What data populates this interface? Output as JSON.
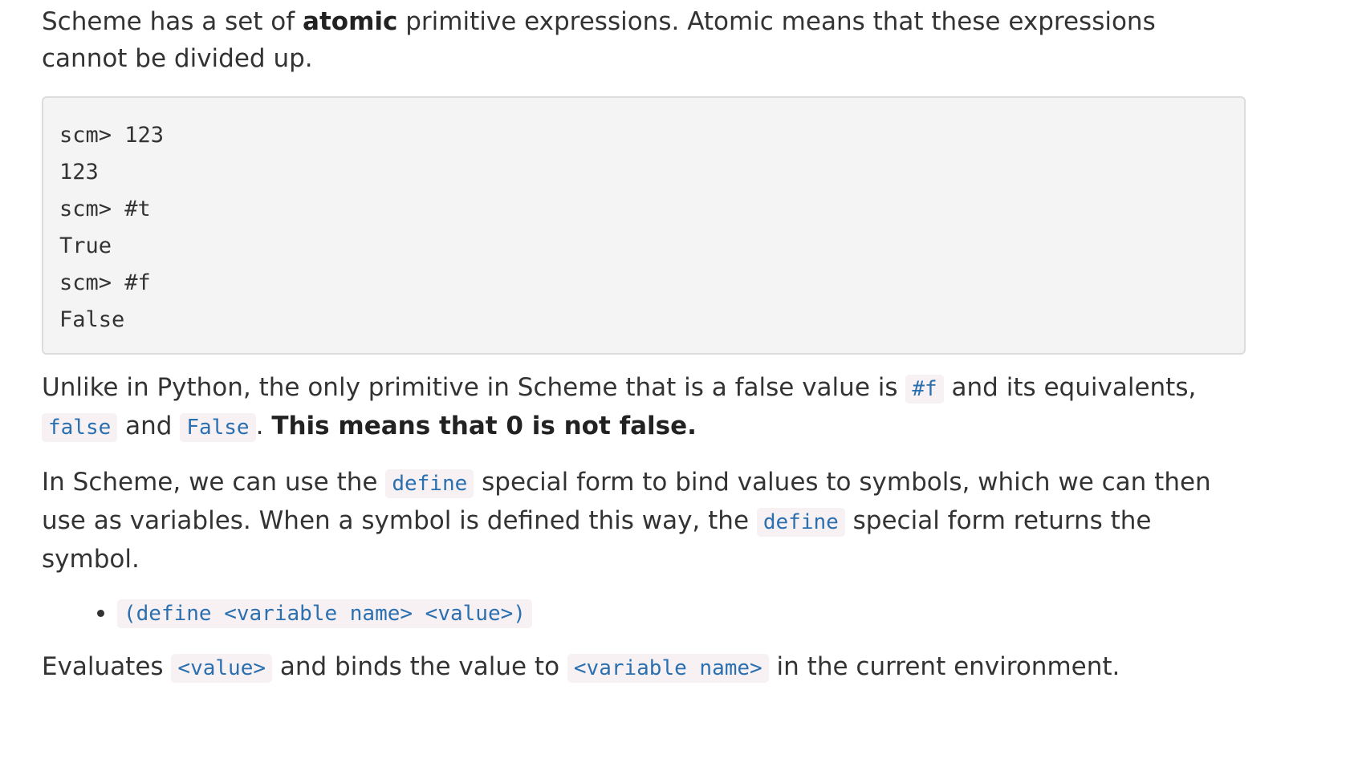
{
  "intro": {
    "text_before": "Scheme has a set of ",
    "bold": "atomic",
    "text_after": " primitive expressions. Atomic means that these expressions cannot be divided up."
  },
  "code_block": {
    "lines": [
      "scm> 123",
      "123",
      "scm> #t",
      "True",
      "scm> #f",
      "False"
    ]
  },
  "falsy_paragraph": {
    "text1": "Unlike in Python, the only primitive in Scheme that is a false value is ",
    "code1": "#f",
    "text2": " and its equivalents, ",
    "code2": "false",
    "text3": " and ",
    "code3": "False",
    "text4": ". ",
    "bold": "This means that 0 is not false."
  },
  "define_paragraph": {
    "text1": "In Scheme, we can use the ",
    "code1": "define",
    "text2": " special form to bind values to symbols, which we can then use as variables. When a symbol is defined this way, the ",
    "code2": "define",
    "text3": " special form returns the symbol."
  },
  "syntax_list": {
    "items": [
      "(define <variable name> <value>)"
    ]
  },
  "evaluates_paragraph": {
    "text1": "Evaluates ",
    "code1": "<value>",
    "text2": " and binds the value to ",
    "code2": "<variable name>",
    "text3": " in the current environment."
  }
}
